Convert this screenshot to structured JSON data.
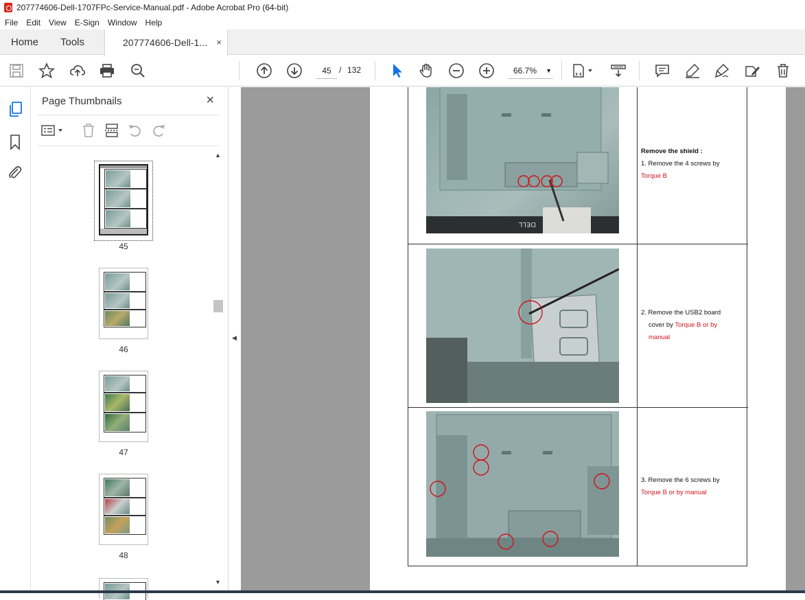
{
  "window": {
    "title": "207774606-Dell-1707FPc-Service-Manual.pdf - Adobe Acrobat Pro (64-bit)"
  },
  "menu": [
    "File",
    "Edit",
    "View",
    "E-Sign",
    "Window",
    "Help"
  ],
  "tabs": {
    "home": "Home",
    "tools": "Tools",
    "document": "207774606-Dell-1...",
    "close": "×"
  },
  "toolbar": {
    "current_page": "45",
    "page_separator": "/",
    "total_pages": "132",
    "zoom": "66.7%"
  },
  "panel": {
    "title": "Page Thumbnails",
    "close": "×",
    "thumbnails": [
      {
        "label": "45",
        "selected": true
      },
      {
        "label": "46",
        "selected": false
      },
      {
        "label": "47",
        "selected": false
      },
      {
        "label": "48",
        "selected": false
      }
    ]
  },
  "document": {
    "steps": [
      {
        "heading": "Remove the shield :",
        "line1": "1. Remove the 4 screws by",
        "red1": "Torque B",
        "red2": ""
      },
      {
        "heading": "",
        "line1": "2. Remove the USB2 board",
        "line2": "cover by",
        "red1": "Torque B or by",
        "red2": "manual"
      },
      {
        "heading": "",
        "line1": "3. Remove the 6 screws by",
        "red1": "Torque B or by manual",
        "red2": ""
      }
    ]
  },
  "icons": [
    "save-icon",
    "star-icon",
    "upload-icon",
    "print-icon",
    "zoom-search-icon",
    "page-up-icon",
    "page-down-icon",
    "select-cursor-icon",
    "hand-icon",
    "zoom-out-icon",
    "zoom-in-icon",
    "fit-page-icon",
    "scroll-mode-icon",
    "comment-icon",
    "highlight-icon",
    "sign-icon",
    "edit-icon",
    "delete-icon"
  ],
  "colors": {
    "accent_blue": "#1473e6",
    "annotation_red": "#d0121a",
    "viewer_gray": "#9b9b9b"
  }
}
